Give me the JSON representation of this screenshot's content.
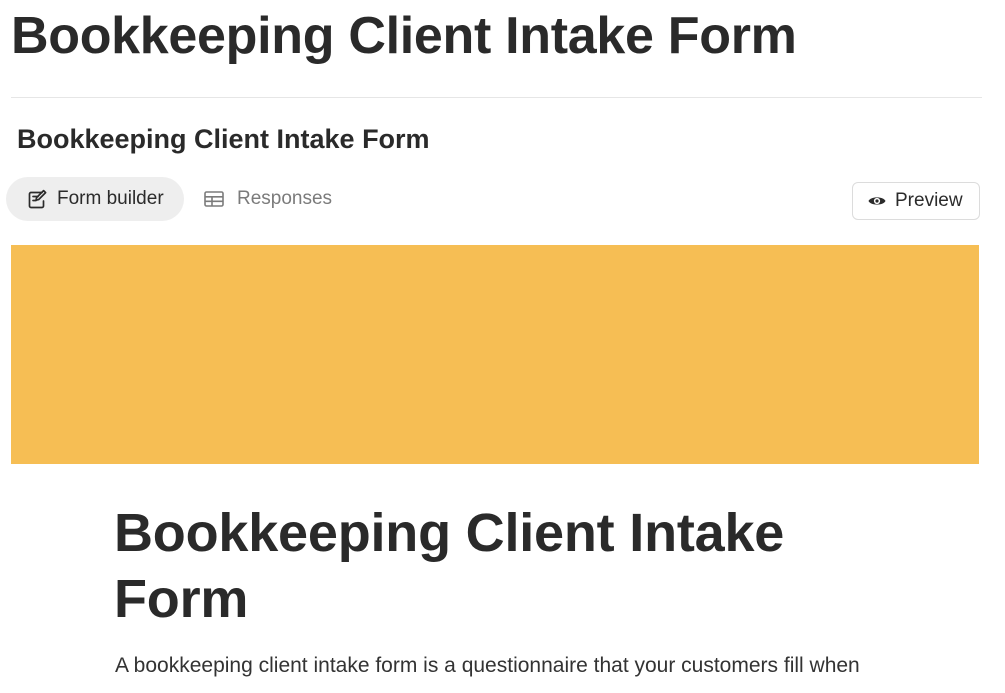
{
  "page": {
    "title": "Bookkeeping Client Intake Form"
  },
  "form_header": {
    "title": "Bookkeeping Client Intake Form"
  },
  "tabs": [
    {
      "label": "Form builder",
      "icon": "edit-form-icon",
      "active": true
    },
    {
      "label": "Responses",
      "icon": "table-icon",
      "active": false
    }
  ],
  "preview": {
    "label": "Preview",
    "icon": "eye-icon"
  },
  "cover": {
    "color": "#F6BE54"
  },
  "form": {
    "title": "Bookkeeping Client Intake Form",
    "description": "A bookkeeping client intake form is a questionnaire that your customers fill when"
  },
  "colors": {
    "accent_cover": "#F6BE54",
    "active_tab_bg": "#EEEEEE",
    "text_primary": "#2A2A2A",
    "text_muted": "#7B7B7B"
  }
}
